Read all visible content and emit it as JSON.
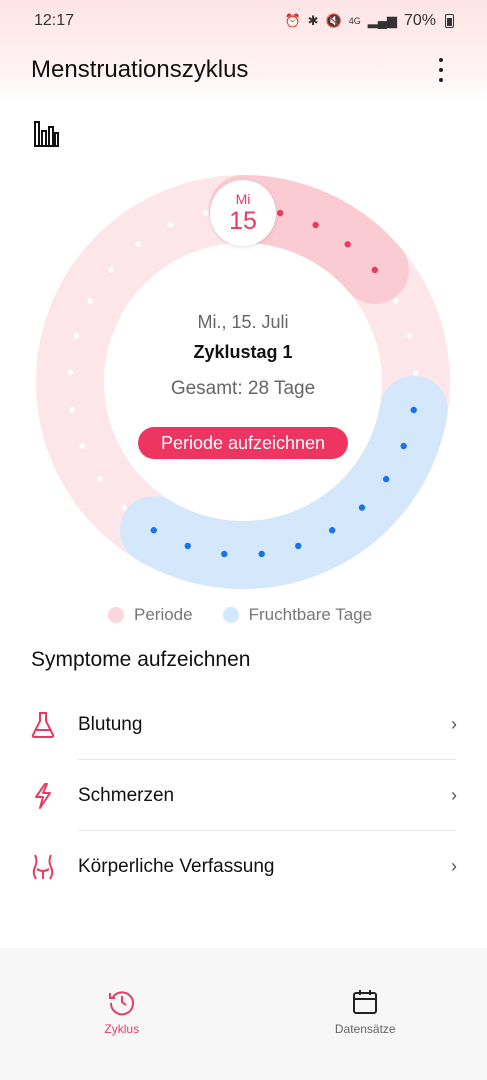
{
  "status_bar": {
    "time": "12:17",
    "signal": "4G",
    "battery": "70%"
  },
  "app_bar": {
    "title": "Menstruationszyklus"
  },
  "cycle": {
    "selected_weekday": "Mi",
    "selected_day": "15",
    "date_text": "Mi., 15. Juli",
    "cycle_day_text": "Zyklustag 1",
    "total_text": "Gesamt: 28 Tage",
    "record_button": "Periode aufzeichnen",
    "total_days": 28,
    "period_days": 5,
    "fertile_days": 10,
    "colors": {
      "period_arc": "#fbcbd3",
      "period_dot": "#e83b64",
      "fertile_arc": "#d5e8fb",
      "fertile_dot": "#1a73e8",
      "ring": "#fde6e9"
    }
  },
  "legend": {
    "period": "Periode",
    "fertile": "Fruchtbare Tage"
  },
  "symptoms": {
    "title": "Symptome aufzeichnen",
    "items": [
      {
        "label": "Blutung",
        "icon": "flask-icon"
      },
      {
        "label": "Schmerzen",
        "icon": "lightning-icon"
      },
      {
        "label": "Körperliche Verfassung",
        "icon": "body-icon"
      }
    ]
  },
  "bottom_nav": {
    "items": [
      {
        "label": "Zyklus",
        "icon": "history-icon",
        "active": true
      },
      {
        "label": "Datensätze",
        "icon": "calendar-icon",
        "active": false
      }
    ]
  }
}
